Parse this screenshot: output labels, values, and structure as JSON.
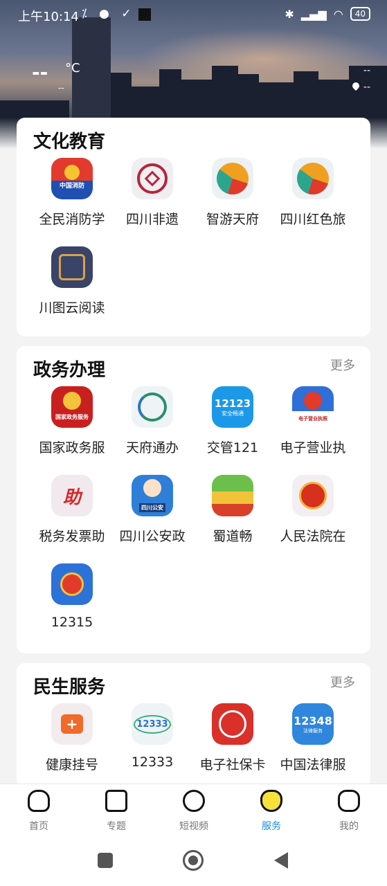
{
  "status_bar": {
    "time": "上午10:14",
    "icons": "⁒ ● ✓",
    "bt": "✱",
    "signal": "▂▄▆",
    "wifi": "◠",
    "battery": "40"
  },
  "weather": {
    "temperature": "--",
    "unit": "°C",
    "sub": "--"
  },
  "location": {
    "top": "--",
    "bottom": "--"
  },
  "sections": {
    "culture": {
      "title": "文化教育",
      "apps": [
        "全民消防学",
        "四川非遗",
        "智游天府",
        "四川红色旅",
        "川图云阅读"
      ]
    },
    "gov": {
      "title": "政务办理",
      "more": "更多",
      "apps": [
        "国家政务服",
        "天府通办",
        "交管121",
        "电子营业执",
        "税务发票助",
        "四川公安政",
        "蜀道畅",
        "人民法院在",
        "12315"
      ]
    },
    "life": {
      "title": "民生服务",
      "more": "更多",
      "apps": [
        "健康挂号",
        "12333",
        "电子社保卡",
        "中国法律服"
      ]
    }
  },
  "icon_text": {
    "fire": "中国消防",
    "gov": "国家政务服务",
    "traffic": "12123",
    "traffic_sub": "安全畅通",
    "biz": "电子营业执照",
    "tax": "助",
    "police": "四川公安",
    "ss": "12333",
    "legal": "12348",
    "legal_sub": "法律服务"
  },
  "bottom_nav": [
    "首页",
    "专题",
    "短视频",
    "服务",
    "我的"
  ]
}
